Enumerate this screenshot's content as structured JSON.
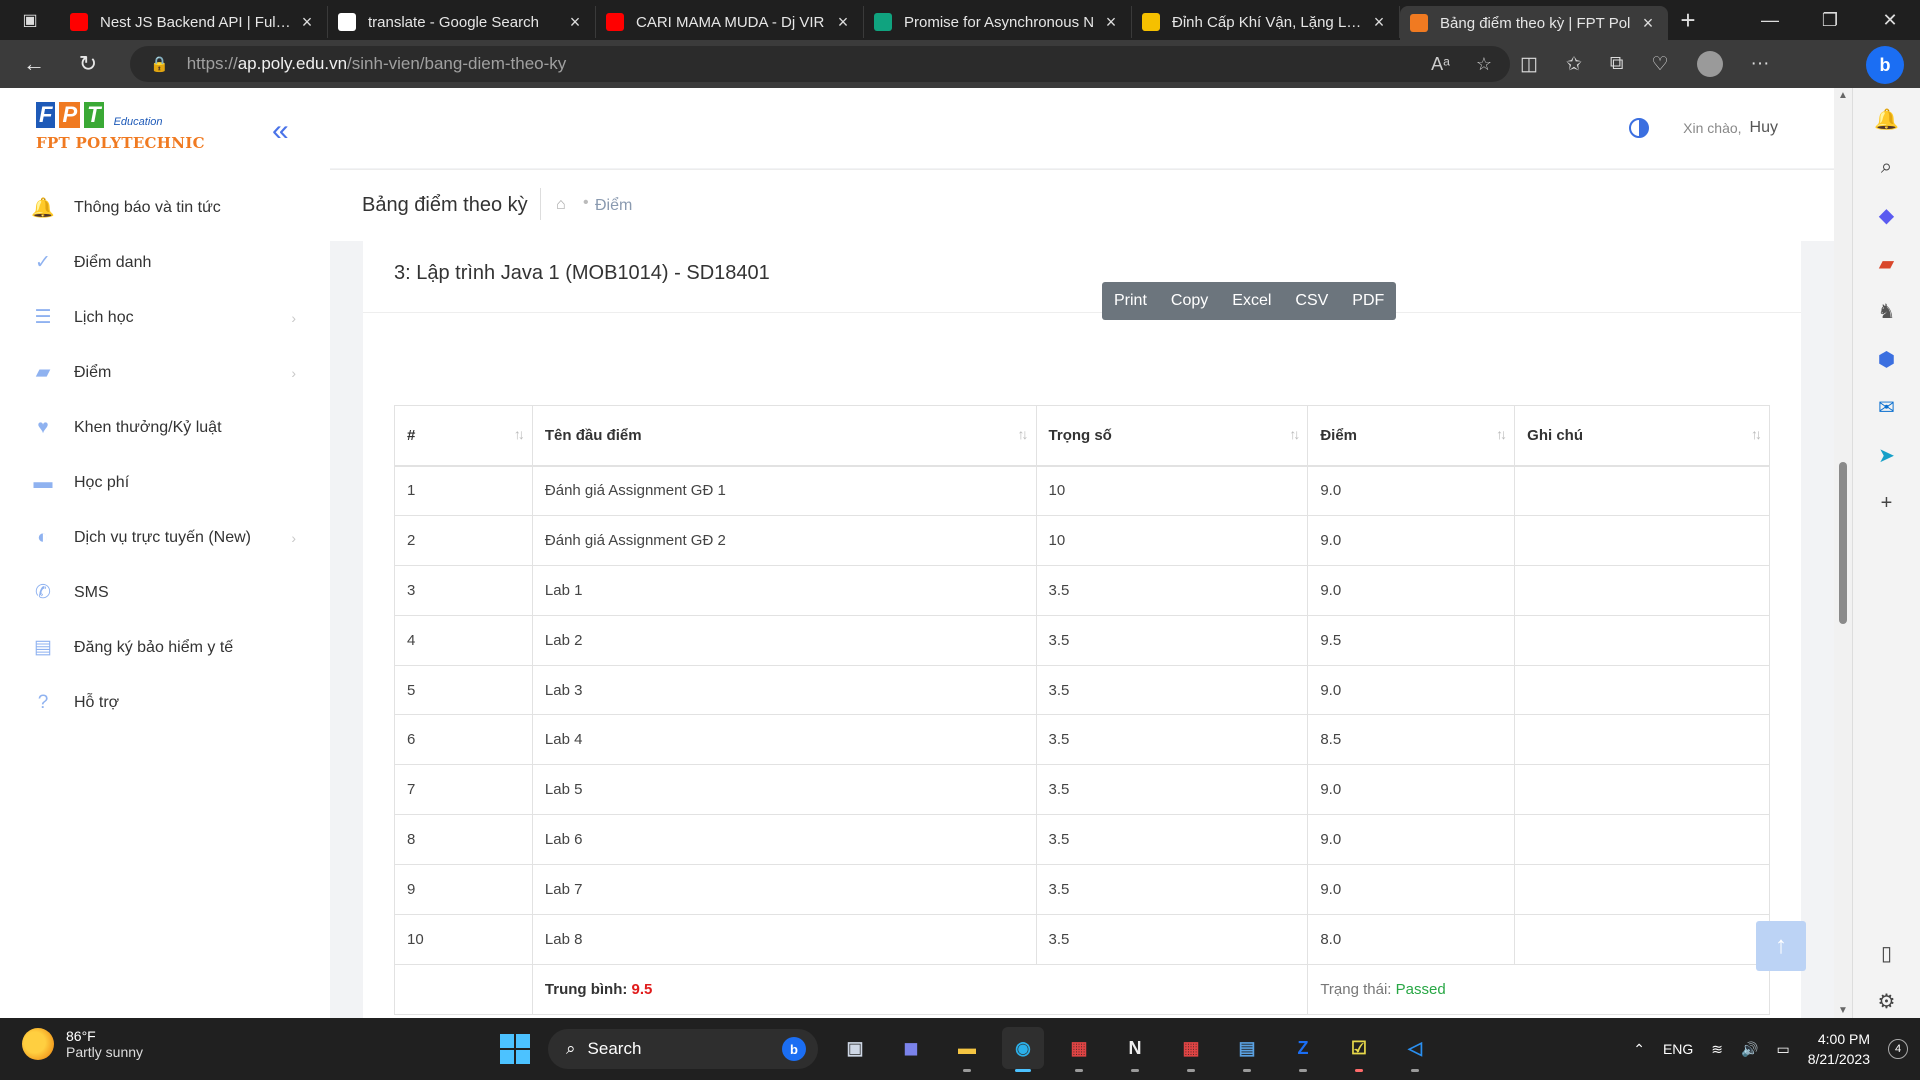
{
  "browser": {
    "tabs": [
      {
        "title": "Nest JS Backend API | Full D",
        "favicon": "youtube-icon",
        "color": "#ff0000",
        "active": false
      },
      {
        "title": "translate - Google Search",
        "favicon": "google-icon",
        "color": "#ffffff",
        "active": false
      },
      {
        "title": "CARI MAMA MUDA - Dj VIR",
        "favicon": "youtube-icon",
        "color": "#ff0000",
        "active": false
      },
      {
        "title": "Promise for Asynchronous N",
        "favicon": "openai-icon",
        "color": "#10a37f",
        "active": false
      },
      {
        "title": "Đỉnh Cấp Khí Vận, Lặng Lẽ T",
        "favicon": "n-icon",
        "color": "#f5c000",
        "active": false
      },
      {
        "title": "Bảng điểm theo kỳ | FPT Pol",
        "favicon": "fpt-icon",
        "color": "#f07a21",
        "active": true
      }
    ],
    "url_prefix": "https://",
    "url_host": "ap.poly.edu.vn",
    "url_path": "/sinh-vien/bang-diem-theo-ky"
  },
  "sidebar": {
    "logo_letters": [
      "F",
      "P",
      "T"
    ],
    "logo_edu": "Education",
    "logo_name": "FPT POLYTECHNIC",
    "items": [
      {
        "label": "Thông báo và tin tức",
        "icon": "bell-icon",
        "has_children": false
      },
      {
        "label": "Điểm danh",
        "icon": "check-icon",
        "has_children": false
      },
      {
        "label": "Lịch học",
        "icon": "list-icon",
        "has_children": true
      },
      {
        "label": "Điểm",
        "icon": "book-icon",
        "has_children": true
      },
      {
        "label": "Khen thưởng/Kỷ luật",
        "icon": "heart-icon",
        "has_children": false
      },
      {
        "label": "Học phí",
        "icon": "wallet-icon",
        "has_children": false
      },
      {
        "label": "Dịch vụ trực tuyến (New)",
        "icon": "globe-icon",
        "has_children": true
      },
      {
        "label": "SMS",
        "icon": "phone-icon",
        "has_children": false
      },
      {
        "label": "Đăng ký bảo hiểm y tế",
        "icon": "document-icon",
        "has_children": false
      },
      {
        "label": "Hỗ trợ",
        "icon": "help-icon",
        "has_children": false
      }
    ]
  },
  "header": {
    "greeting": "Xin chào,",
    "user_name": "Huy"
  },
  "breadcrumb": {
    "page_title": "Bảng điểm theo kỳ",
    "crumb": "Điểm"
  },
  "course": {
    "title": "3: Lập trình Java 1 (MOB1014) - SD18401"
  },
  "export_buttons": [
    "Print",
    "Copy",
    "Excel",
    "CSV",
    "PDF"
  ],
  "table": {
    "columns": [
      "#",
      "Tên đầu điểm",
      "Trọng số",
      "Điểm",
      "Ghi chú"
    ],
    "rows": [
      [
        "1",
        "Đánh giá Assignment GĐ 1",
        "10",
        "9.0",
        ""
      ],
      [
        "2",
        "Đánh giá Assignment GĐ 2",
        "10",
        "9.0",
        ""
      ],
      [
        "3",
        "Lab 1",
        "3.5",
        "9.0",
        ""
      ],
      [
        "4",
        "Lab 2",
        "3.5",
        "9.5",
        ""
      ],
      [
        "5",
        "Lab 3",
        "3.5",
        "9.0",
        ""
      ],
      [
        "6",
        "Lab 4",
        "3.5",
        "8.5",
        ""
      ],
      [
        "7",
        "Lab 5",
        "3.5",
        "9.0",
        ""
      ],
      [
        "8",
        "Lab 6",
        "3.5",
        "9.0",
        ""
      ],
      [
        "9",
        "Lab 7",
        "3.5",
        "9.0",
        ""
      ],
      [
        "10",
        "Lab 8",
        "3.5",
        "8.0",
        ""
      ]
    ],
    "average_label": "Trung bình:",
    "average_value": "9.5",
    "status_label": "Trạng thái:",
    "status_value": "Passed"
  },
  "taskbar": {
    "temperature": "86°F",
    "condition": "Partly sunny",
    "search_placeholder": "Search",
    "language": "ENG",
    "time": "4:00 PM",
    "date": "8/21/2023",
    "notification_count": "4"
  },
  "colors": {
    "accent": "#4a73e8",
    "brand_orange": "#f07a21",
    "average_red": "#e01b1b",
    "passed_green": "#28a745"
  }
}
